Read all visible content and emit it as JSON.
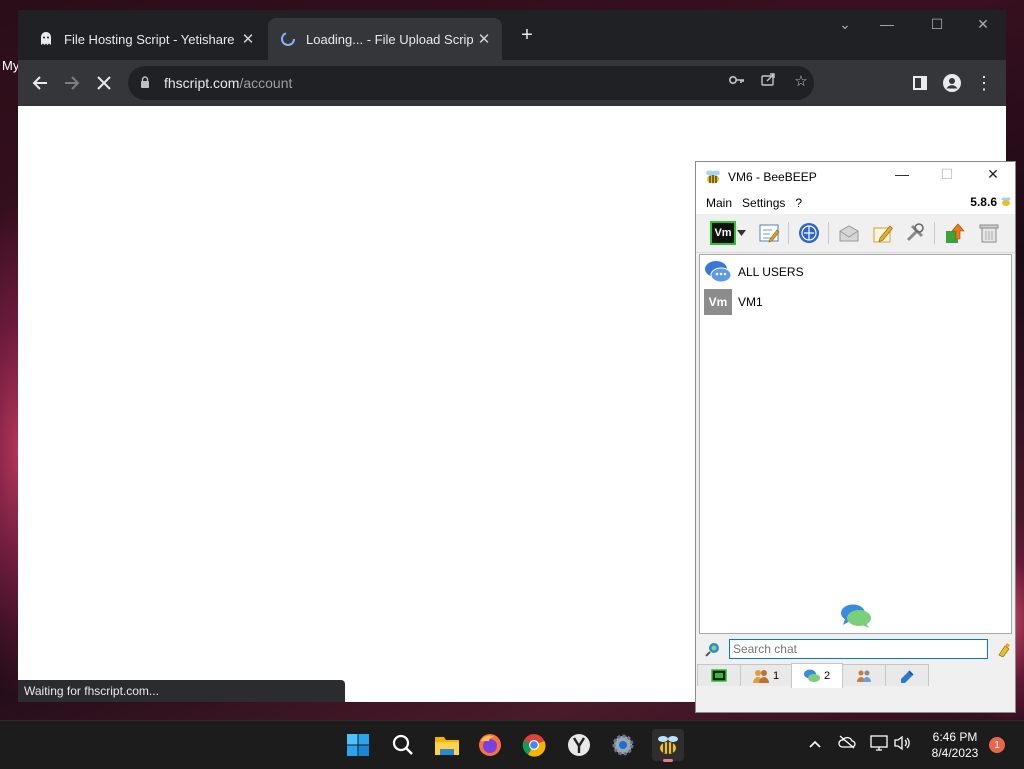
{
  "desktop": {
    "label": "My"
  },
  "browser": {
    "tabs": [
      {
        "title": "File Hosting Script - Yetishare",
        "icon": "ghost-icon",
        "active": false
      },
      {
        "title": "Loading... - File Upload Script",
        "icon": "loading-icon",
        "active": true
      }
    ],
    "url_host": "fhscript.com",
    "url_path": "/account",
    "status_text": "Waiting for fhscript.com..."
  },
  "beebeep": {
    "title": "VM6 - BeeBEEP",
    "menu": [
      "Main",
      "Settings",
      "?"
    ],
    "version": "5.8.6",
    "user_badge": "Vm",
    "users": [
      {
        "name": "ALL USERS",
        "icon": "all-users-icon"
      },
      {
        "name": "VM1",
        "avatar": "Vm"
      }
    ],
    "search_placeholder": "Search chat",
    "tabs": [
      {
        "icon": "home-icon",
        "count": ""
      },
      {
        "icon": "users-icon",
        "count": "1"
      },
      {
        "icon": "chat-icon",
        "count": "2"
      },
      {
        "icon": "groups-icon",
        "count": ""
      },
      {
        "icon": "plugin-icon",
        "count": ""
      }
    ]
  },
  "taskbar": {
    "time": "6:46 PM",
    "date": "8/4/2023",
    "notification_count": "1"
  },
  "colors": {
    "chrome_dark": "#202124",
    "chrome_toolbar": "#35363a",
    "accent_blue": "#0078d4",
    "vm_badge_border": "#2fbf2f"
  }
}
